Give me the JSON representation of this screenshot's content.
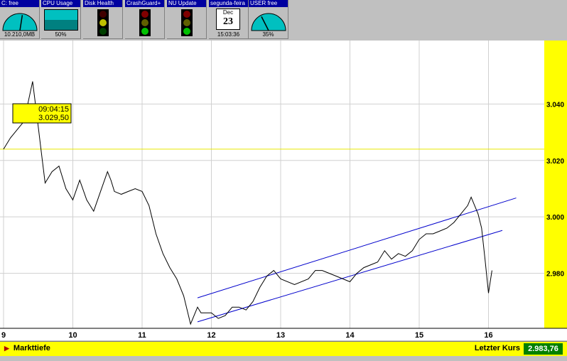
{
  "toolbar": {
    "disk": {
      "title": "C: free",
      "footer": "10.210,0MB",
      "level": 0.55
    },
    "cpu": {
      "title": "CPU Usage",
      "footer": "50%",
      "level": 0.5
    },
    "disk_health": {
      "title": "Disk Health"
    },
    "crashguard": {
      "title": "CrashGuard+"
    },
    "nu_update": {
      "title": "NU Update"
    },
    "calendar": {
      "title": "segunda-feira",
      "month": "Dec",
      "day": "23",
      "time": "15:03:36"
    },
    "user": {
      "title": "USER free",
      "footer": "35%",
      "level": 0.35
    }
  },
  "tooltip": {
    "time": "09:04:15",
    "value": "3.029,50"
  },
  "chart_data": {
    "type": "line",
    "title": "",
    "x_ticks": [
      "9",
      "10",
      "11",
      "12",
      "13",
      "14",
      "15",
      "16"
    ],
    "y_ticks": [
      "3.040",
      "3.020",
      "3.000",
      "2.980"
    ],
    "ylim": [
      2.9605,
      3.0625
    ],
    "grid": true,
    "series": [
      {
        "x": [
          9.0,
          9.1,
          9.2,
          9.3,
          9.35,
          9.42,
          9.5,
          9.55,
          9.6,
          9.7,
          9.8,
          9.9,
          10.0,
          10.1,
          10.2,
          10.3,
          10.4,
          10.5,
          10.55,
          10.6,
          10.7,
          10.8,
          10.9,
          11.0,
          11.1,
          11.15,
          11.2,
          11.3,
          11.4,
          11.5,
          11.6,
          11.7,
          11.8,
          11.85,
          11.9,
          12.0,
          12.1,
          12.2,
          12.3,
          12.4,
          12.5,
          12.6,
          12.7,
          12.8,
          12.9,
          13.0,
          13.2,
          13.4,
          13.5,
          13.6,
          13.8,
          14.0,
          14.1,
          14.2,
          14.4,
          14.5,
          14.6,
          14.7,
          14.8,
          14.9,
          15.0,
          15.1,
          15.2,
          15.3,
          15.4,
          15.5,
          15.6,
          15.7,
          15.75,
          15.8,
          15.85,
          15.9,
          15.95,
          16.0,
          16.05
        ],
        "y": [
          3.024,
          3.028,
          3.031,
          3.034,
          3.04,
          3.048,
          3.032,
          3.022,
          3.012,
          3.016,
          3.018,
          3.01,
          3.006,
          3.013,
          3.006,
          3.002,
          3.009,
          3.016,
          3.013,
          3.009,
          3.008,
          3.009,
          3.01,
          3.009,
          3.004,
          2.999,
          2.994,
          2.987,
          2.982,
          2.978,
          2.972,
          2.962,
          2.968,
          2.966,
          2.966,
          2.966,
          2.964,
          2.965,
          2.968,
          2.968,
          2.967,
          2.97,
          2.975,
          2.979,
          2.981,
          2.978,
          2.976,
          2.978,
          2.981,
          2.981,
          2.979,
          2.977,
          2.98,
          2.982,
          2.984,
          2.988,
          2.985,
          2.987,
          2.986,
          2.988,
          2.992,
          2.994,
          2.994,
          2.995,
          2.996,
          2.998,
          3.001,
          3.004,
          3.007,
          3.004,
          3.001,
          2.996,
          2.985,
          2.973,
          2.981
        ]
      }
    ],
    "channel_upper": {
      "x": [
        11.8,
        16.4
      ],
      "y": [
        2.9713,
        3.0067
      ]
    },
    "channel_lower": {
      "x": [
        11.8,
        16.2
      ],
      "y": [
        2.9628,
        2.9952
      ]
    },
    "ref_line_y": 3.024,
    "current_value": 3.0295,
    "colors": {
      "line": "#000000",
      "channel": "#0000cc",
      "ref": "#e6e600",
      "tooltip_bg": "#ffff00",
      "yaxis_bg": "#ffff00"
    }
  },
  "status": {
    "marktiefe_label": "Markttiefe",
    "last_label": "Letzter Kurs",
    "last_value": "2.983,76"
  }
}
